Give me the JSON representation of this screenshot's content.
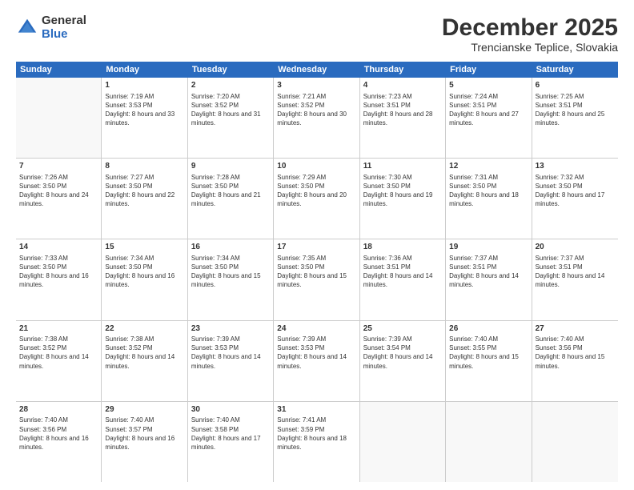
{
  "logo": {
    "general": "General",
    "blue": "Blue"
  },
  "title": "December 2025",
  "subtitle": "Trencianske Teplice, Slovakia",
  "header_days": [
    "Sunday",
    "Monday",
    "Tuesday",
    "Wednesday",
    "Thursday",
    "Friday",
    "Saturday"
  ],
  "weeks": [
    [
      {
        "day": "",
        "sunrise": "",
        "sunset": "",
        "daylight": "",
        "empty": true
      },
      {
        "day": "1",
        "sunrise": "Sunrise: 7:19 AM",
        "sunset": "Sunset: 3:53 PM",
        "daylight": "Daylight: 8 hours and 33 minutes."
      },
      {
        "day": "2",
        "sunrise": "Sunrise: 7:20 AM",
        "sunset": "Sunset: 3:52 PM",
        "daylight": "Daylight: 8 hours and 31 minutes."
      },
      {
        "day": "3",
        "sunrise": "Sunrise: 7:21 AM",
        "sunset": "Sunset: 3:52 PM",
        "daylight": "Daylight: 8 hours and 30 minutes."
      },
      {
        "day": "4",
        "sunrise": "Sunrise: 7:23 AM",
        "sunset": "Sunset: 3:51 PM",
        "daylight": "Daylight: 8 hours and 28 minutes."
      },
      {
        "day": "5",
        "sunrise": "Sunrise: 7:24 AM",
        "sunset": "Sunset: 3:51 PM",
        "daylight": "Daylight: 8 hours and 27 minutes."
      },
      {
        "day": "6",
        "sunrise": "Sunrise: 7:25 AM",
        "sunset": "Sunset: 3:51 PM",
        "daylight": "Daylight: 8 hours and 25 minutes."
      }
    ],
    [
      {
        "day": "7",
        "sunrise": "Sunrise: 7:26 AM",
        "sunset": "Sunset: 3:50 PM",
        "daylight": "Daylight: 8 hours and 24 minutes."
      },
      {
        "day": "8",
        "sunrise": "Sunrise: 7:27 AM",
        "sunset": "Sunset: 3:50 PM",
        "daylight": "Daylight: 8 hours and 22 minutes."
      },
      {
        "day": "9",
        "sunrise": "Sunrise: 7:28 AM",
        "sunset": "Sunset: 3:50 PM",
        "daylight": "Daylight: 8 hours and 21 minutes."
      },
      {
        "day": "10",
        "sunrise": "Sunrise: 7:29 AM",
        "sunset": "Sunset: 3:50 PM",
        "daylight": "Daylight: 8 hours and 20 minutes."
      },
      {
        "day": "11",
        "sunrise": "Sunrise: 7:30 AM",
        "sunset": "Sunset: 3:50 PM",
        "daylight": "Daylight: 8 hours and 19 minutes."
      },
      {
        "day": "12",
        "sunrise": "Sunrise: 7:31 AM",
        "sunset": "Sunset: 3:50 PM",
        "daylight": "Daylight: 8 hours and 18 minutes."
      },
      {
        "day": "13",
        "sunrise": "Sunrise: 7:32 AM",
        "sunset": "Sunset: 3:50 PM",
        "daylight": "Daylight: 8 hours and 17 minutes."
      }
    ],
    [
      {
        "day": "14",
        "sunrise": "Sunrise: 7:33 AM",
        "sunset": "Sunset: 3:50 PM",
        "daylight": "Daylight: 8 hours and 16 minutes."
      },
      {
        "day": "15",
        "sunrise": "Sunrise: 7:34 AM",
        "sunset": "Sunset: 3:50 PM",
        "daylight": "Daylight: 8 hours and 16 minutes."
      },
      {
        "day": "16",
        "sunrise": "Sunrise: 7:34 AM",
        "sunset": "Sunset: 3:50 PM",
        "daylight": "Daylight: 8 hours and 15 minutes."
      },
      {
        "day": "17",
        "sunrise": "Sunrise: 7:35 AM",
        "sunset": "Sunset: 3:50 PM",
        "daylight": "Daylight: 8 hours and 15 minutes."
      },
      {
        "day": "18",
        "sunrise": "Sunrise: 7:36 AM",
        "sunset": "Sunset: 3:51 PM",
        "daylight": "Daylight: 8 hours and 14 minutes."
      },
      {
        "day": "19",
        "sunrise": "Sunrise: 7:37 AM",
        "sunset": "Sunset: 3:51 PM",
        "daylight": "Daylight: 8 hours and 14 minutes."
      },
      {
        "day": "20",
        "sunrise": "Sunrise: 7:37 AM",
        "sunset": "Sunset: 3:51 PM",
        "daylight": "Daylight: 8 hours and 14 minutes."
      }
    ],
    [
      {
        "day": "21",
        "sunrise": "Sunrise: 7:38 AM",
        "sunset": "Sunset: 3:52 PM",
        "daylight": "Daylight: 8 hours and 14 minutes."
      },
      {
        "day": "22",
        "sunrise": "Sunrise: 7:38 AM",
        "sunset": "Sunset: 3:52 PM",
        "daylight": "Daylight: 8 hours and 14 minutes."
      },
      {
        "day": "23",
        "sunrise": "Sunrise: 7:39 AM",
        "sunset": "Sunset: 3:53 PM",
        "daylight": "Daylight: 8 hours and 14 minutes."
      },
      {
        "day": "24",
        "sunrise": "Sunrise: 7:39 AM",
        "sunset": "Sunset: 3:53 PM",
        "daylight": "Daylight: 8 hours and 14 minutes."
      },
      {
        "day": "25",
        "sunrise": "Sunrise: 7:39 AM",
        "sunset": "Sunset: 3:54 PM",
        "daylight": "Daylight: 8 hours and 14 minutes."
      },
      {
        "day": "26",
        "sunrise": "Sunrise: 7:40 AM",
        "sunset": "Sunset: 3:55 PM",
        "daylight": "Daylight: 8 hours and 15 minutes."
      },
      {
        "day": "27",
        "sunrise": "Sunrise: 7:40 AM",
        "sunset": "Sunset: 3:56 PM",
        "daylight": "Daylight: 8 hours and 15 minutes."
      }
    ],
    [
      {
        "day": "28",
        "sunrise": "Sunrise: 7:40 AM",
        "sunset": "Sunset: 3:56 PM",
        "daylight": "Daylight: 8 hours and 16 minutes."
      },
      {
        "day": "29",
        "sunrise": "Sunrise: 7:40 AM",
        "sunset": "Sunset: 3:57 PM",
        "daylight": "Daylight: 8 hours and 16 minutes."
      },
      {
        "day": "30",
        "sunrise": "Sunrise: 7:40 AM",
        "sunset": "Sunset: 3:58 PM",
        "daylight": "Daylight: 8 hours and 17 minutes."
      },
      {
        "day": "31",
        "sunrise": "Sunrise: 7:41 AM",
        "sunset": "Sunset: 3:59 PM",
        "daylight": "Daylight: 8 hours and 18 minutes."
      },
      {
        "day": "",
        "sunrise": "",
        "sunset": "",
        "daylight": "",
        "empty": true
      },
      {
        "day": "",
        "sunrise": "",
        "sunset": "",
        "daylight": "",
        "empty": true
      },
      {
        "day": "",
        "sunrise": "",
        "sunset": "",
        "daylight": "",
        "empty": true
      }
    ]
  ]
}
